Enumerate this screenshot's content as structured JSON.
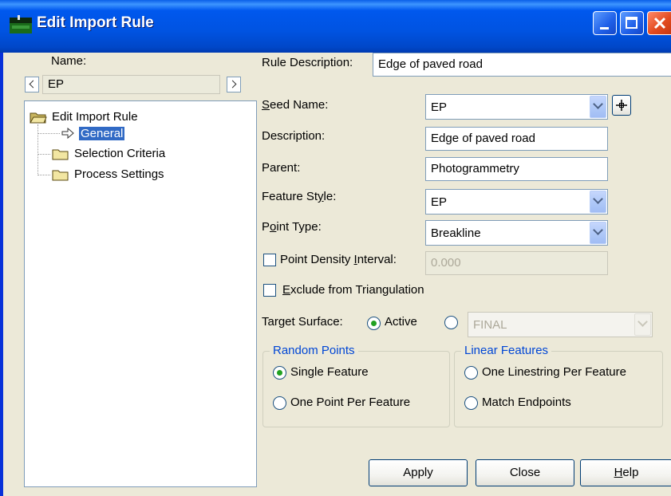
{
  "window": {
    "title": "Edit Import Rule"
  },
  "left": {
    "name_label": "Name:",
    "name_value": "EP",
    "tree": {
      "root": "Edit Import Rule",
      "items": [
        "General",
        "Selection Criteria",
        "Process Settings"
      ],
      "selected": "General"
    }
  },
  "form": {
    "rule_description_label": "Rule Description:",
    "rule_description_value": "Edge of paved road",
    "seed_name_label_u": "S",
    "seed_name_label_rest": "eed Name:",
    "seed_name_value": "EP",
    "description_label": "Description:",
    "description_value": "Edge of paved road",
    "parent_label": "Parent:",
    "parent_value": "Photogrammetry",
    "feature_style_label_a": "Feature St",
    "feature_style_label_u": "y",
    "feature_style_label_b": "le:",
    "feature_style_value": "EP",
    "point_type_label_a": "P",
    "point_type_label_u": "o",
    "point_type_label_b": "int Type:",
    "point_type_value": "Breakline",
    "point_density_label_a": "Point Density ",
    "point_density_label_u": "I",
    "point_density_label_b": "nterval:",
    "point_density_value": "0.000",
    "point_density_checked": false,
    "exclude_label_u": "E",
    "exclude_label_rest": "xclude from Triangulation",
    "exclude_checked": false,
    "target_surface_label": "Target Surface:",
    "target_active_label": "Active",
    "target_surface_value": "FINAL"
  },
  "random_points": {
    "title": "Random Points",
    "options": [
      "Single Feature",
      "One Point Per Feature"
    ],
    "selected": "Single Feature"
  },
  "linear_features": {
    "title": "Linear Features",
    "options": [
      "One Linestring Per Feature",
      "Match Endpoints"
    ]
  },
  "buttons": {
    "apply": "Apply",
    "close": "Close",
    "help_u": "H",
    "help_rest": "elp"
  },
  "colors": {
    "titlebar": "#0054e3",
    "dialog_bg": "#ece9d8",
    "group_title": "#0046d5",
    "radio_dot": "#21a121"
  }
}
